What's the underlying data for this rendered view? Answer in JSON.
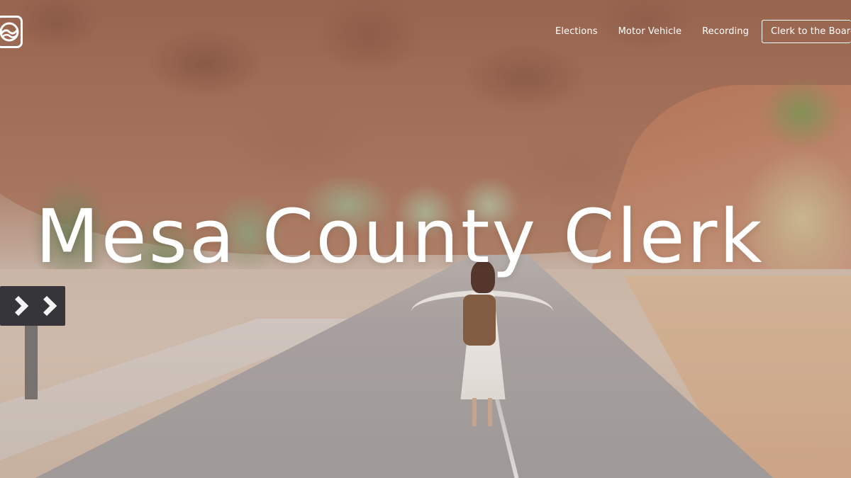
{
  "site": {
    "title": "Mesa County Clerk",
    "logo_icon": "mesa-county-logo-icon"
  },
  "nav": {
    "items": [
      {
        "label": "Elections"
      },
      {
        "label": "Motor Vehicle"
      },
      {
        "label": "Recording"
      },
      {
        "label": "Clerk to the Board"
      }
    ]
  },
  "colors": {
    "text": "#ffffff",
    "sign": "#2a2a2e"
  }
}
